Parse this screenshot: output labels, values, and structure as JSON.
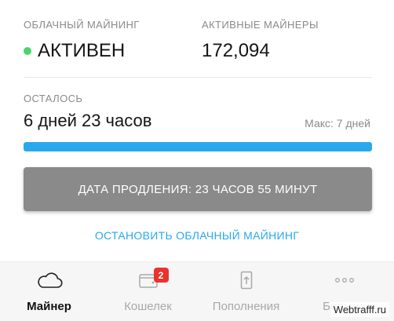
{
  "stats": {
    "mining_label": "ОБЛАЧНЫЙ МАЙНИНГ",
    "mining_status": "АКТИВЕН",
    "miners_label": "АКТИВНЫЕ МАЙНЕРЫ",
    "miners_count": "172,094"
  },
  "remaining": {
    "label": "ОСТАЛОСЬ",
    "value": "6 дней 23 часов",
    "max": "Макс: 7 дней",
    "progress_fraction": 1.0
  },
  "extend_button": {
    "label": "ДАТА ПРОДЛЕНИЯ: 23 ЧАСОВ 55 МИНУТ"
  },
  "stop_link": {
    "label": "ОСТАНОВИТЬ ОБЛАЧНЫЙ МАЙНИНГ"
  },
  "tabs": [
    {
      "label": "Майнер",
      "icon": "cloud-icon",
      "active": true
    },
    {
      "label": "Кошелек",
      "icon": "wallet-icon",
      "active": false,
      "badge": "2"
    },
    {
      "label": "Пополнения",
      "icon": "top-up-icon",
      "active": false
    },
    {
      "label": "Больше",
      "icon": "more-icon",
      "active": false
    }
  ],
  "watermark": "Webtrafff.ru",
  "colors": {
    "accent": "#29a9eb",
    "status_green": "#4cd36a",
    "badge_red": "#e8332e",
    "button_gray": "#8a8a8a"
  }
}
